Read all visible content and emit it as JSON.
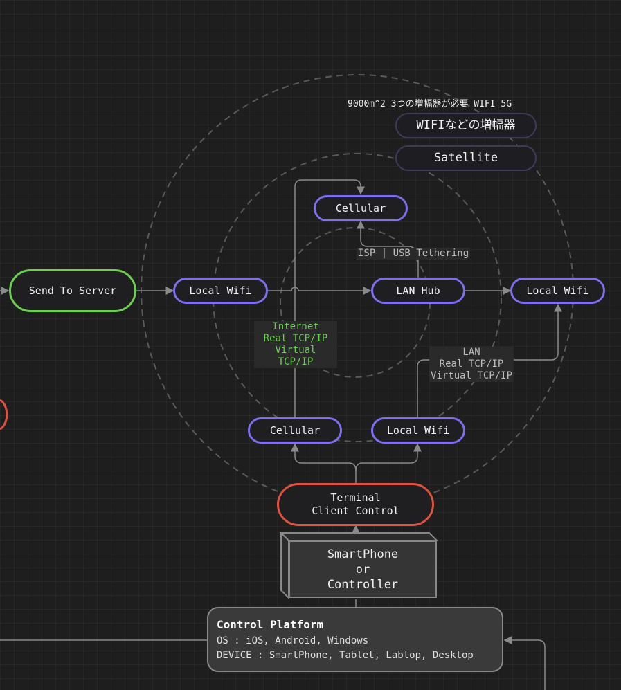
{
  "nodes": {
    "send_to_server": "Send To Server",
    "local_wifi_left": "Local Wifi",
    "lan_hub": "LAN Hub",
    "local_wifi_right": "Local Wifi",
    "cellular_top": "Cellular",
    "cellular_bottom": "Cellular",
    "local_wifi_bottom": "Local Wifi",
    "terminal": "Terminal\nClient Control",
    "wifi_amp": "WIFIなどの増幅器",
    "satellite": "Satellite"
  },
  "labels": {
    "isp": "ISP | USB Tethering",
    "internet": "Internet\nReal TCP/IP\nVirtual TCP/IP",
    "lan": "LAN\nReal TCP/IP\nVirtual TCP/IP"
  },
  "note": "9000m^2 3つの増幅器が必要 WIFI 5G",
  "device": "SmartPhone\nor\nController",
  "platform": {
    "title": "Control Platform",
    "os": "OS : iOS, Android, Windows",
    "device": "DEVICE : SmartPhone, Tablet, Labtop, Desktop"
  },
  "colors": {
    "background": "#1e1e1e",
    "purple": "#7d6ff0",
    "green": "#6ad14f",
    "red": "#e0523f",
    "wire": "#8a8a8a"
  }
}
